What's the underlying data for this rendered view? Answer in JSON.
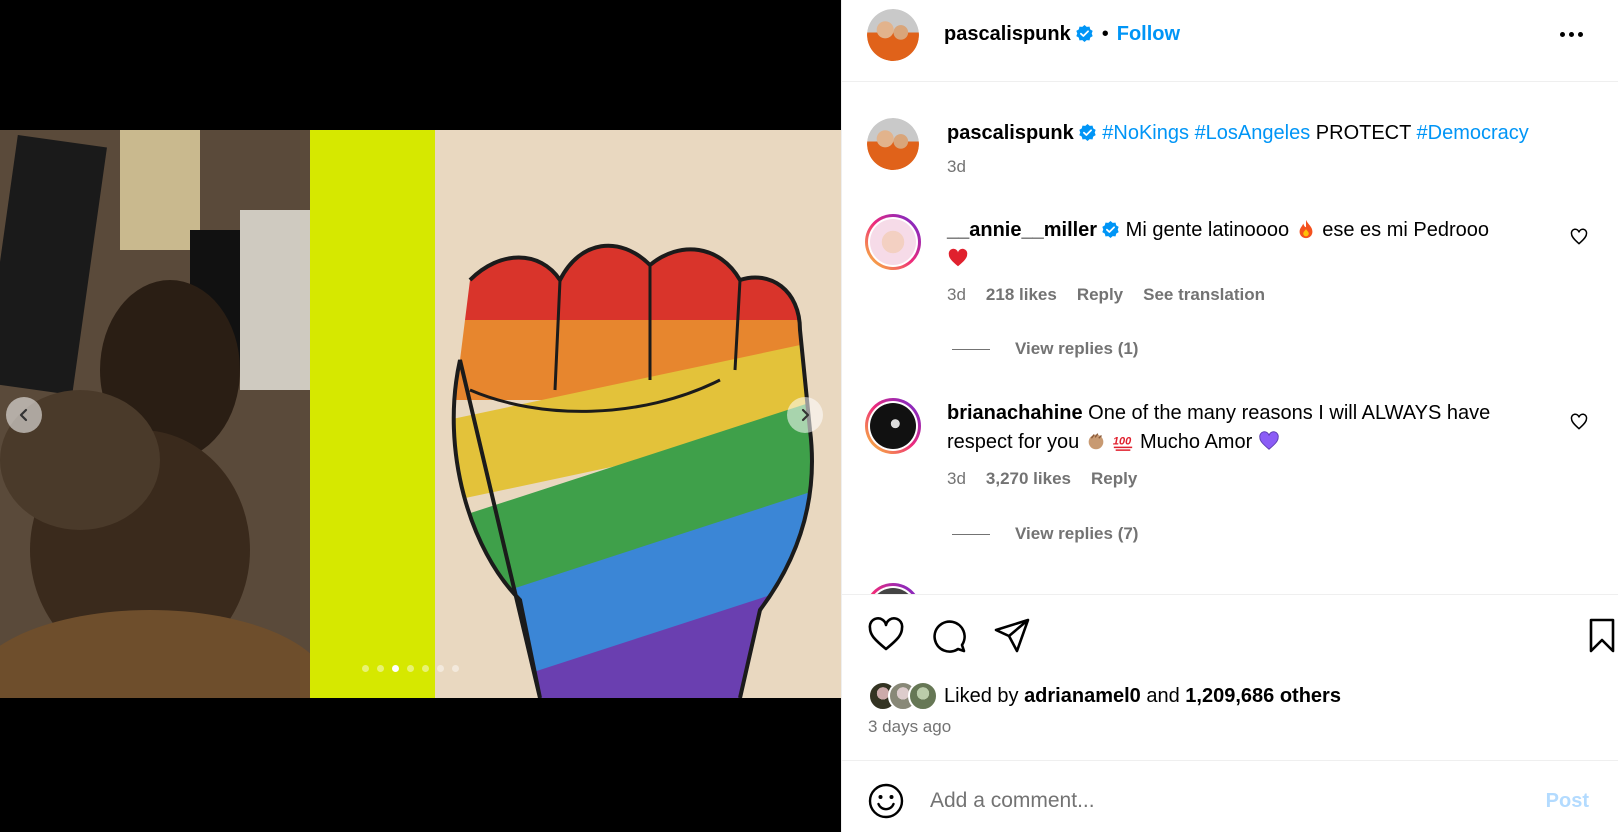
{
  "header": {
    "username": "pascalispunk",
    "separator": "•",
    "follow_label": "Follow"
  },
  "caption": {
    "username": "pascalispunk",
    "hashtag1": "#NoKings",
    "hashtag2": "#LosAngeles",
    "word": "PROTECT",
    "hashtag3": "#Democracy",
    "time": "3d"
  },
  "comments": [
    {
      "username": "__annie__miller",
      "text": "Mi gente latinoooo",
      "text_after_fire": "ese es mi Pedrooo",
      "time": "3d",
      "likes": "218 likes",
      "reply": "Reply",
      "see_translation": "See translation",
      "view_replies": "View replies (1)"
    },
    {
      "username": "brianachahine",
      "text": "One of the many reasons I will ALWAYS have respect for you",
      "text_after_emoji": "Mucho Amor",
      "time": "3d",
      "likes": "3,270 likes",
      "reply": "Reply",
      "view_replies": "View replies (7)"
    }
  ],
  "likes": {
    "prefix": "Liked by",
    "user": "adrianamel0",
    "and": "and",
    "others": "1,209,686 others"
  },
  "date": "3 days ago",
  "add_comment": {
    "placeholder": "Add a comment...",
    "post_label": "Post"
  },
  "carousel": {
    "count": 7,
    "active_index": 2
  },
  "colors": {
    "link": "#0095f6",
    "muted": "#737373",
    "post_disabled": "#b3dbff"
  },
  "icons": [
    "chevron-left-icon",
    "chevron-right-icon",
    "more-icon",
    "verified-icon",
    "heart-icon",
    "comment-icon",
    "share-icon",
    "bookmark-icon",
    "emoji-icon"
  ]
}
